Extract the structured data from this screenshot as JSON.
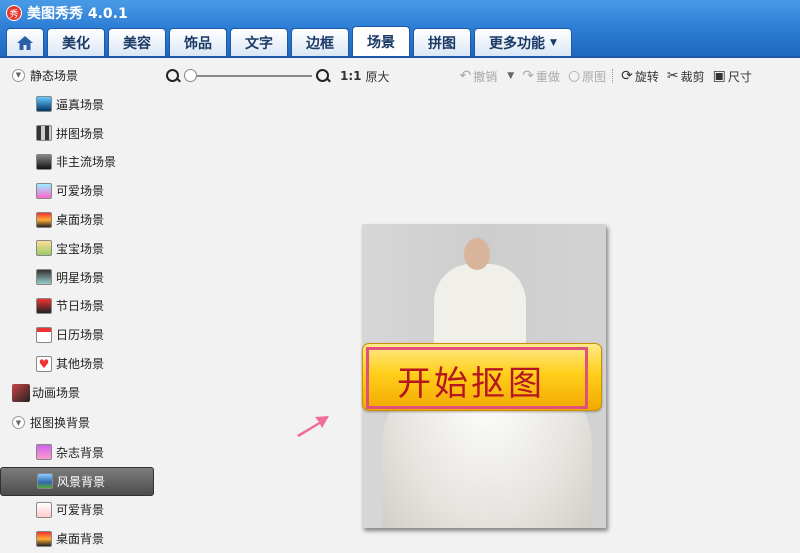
{
  "app": {
    "title": "美图秀秀 4.0.1",
    "logo_text": "秀"
  },
  "tabs": [
    {
      "label": "",
      "icon": "home-icon"
    },
    {
      "label": "美化"
    },
    {
      "label": "美容"
    },
    {
      "label": "饰品"
    },
    {
      "label": "文字"
    },
    {
      "label": "边框"
    },
    {
      "label": "场景",
      "active": true
    },
    {
      "label": "拼图"
    },
    {
      "label": "更多功能"
    }
  ],
  "sidebar": {
    "groups": [
      {
        "label": "静态场景",
        "items": [
          "逼真场景",
          "拼图场景",
          "非主流场景",
          "可爱场景",
          "桌面场景",
          "宝宝场景",
          "明星场景",
          "节日场景",
          "日历场景",
          "其他场景"
        ]
      },
      {
        "label": "动画场景",
        "items": []
      },
      {
        "label": "抠图换背景",
        "items": [
          "杂志背景",
          "风景背景",
          "可爱背景",
          "桌面背景"
        ],
        "selected": "风景背景"
      }
    ]
  },
  "toolbar": {
    "ratio": "1:1",
    "original_size": "原大",
    "undo": "撤销",
    "redo": "重做",
    "original": "原图",
    "rotate": "旋转",
    "crop": "裁剪",
    "size": "尺寸",
    "zoom_level": 0
  },
  "canvas": {
    "start_button_label": "开始抠图"
  },
  "colors": {
    "accent": "#2f7fd6",
    "button_text": "#b61620",
    "button_border": "#e0507c",
    "arrow": "#ef6c9b"
  }
}
